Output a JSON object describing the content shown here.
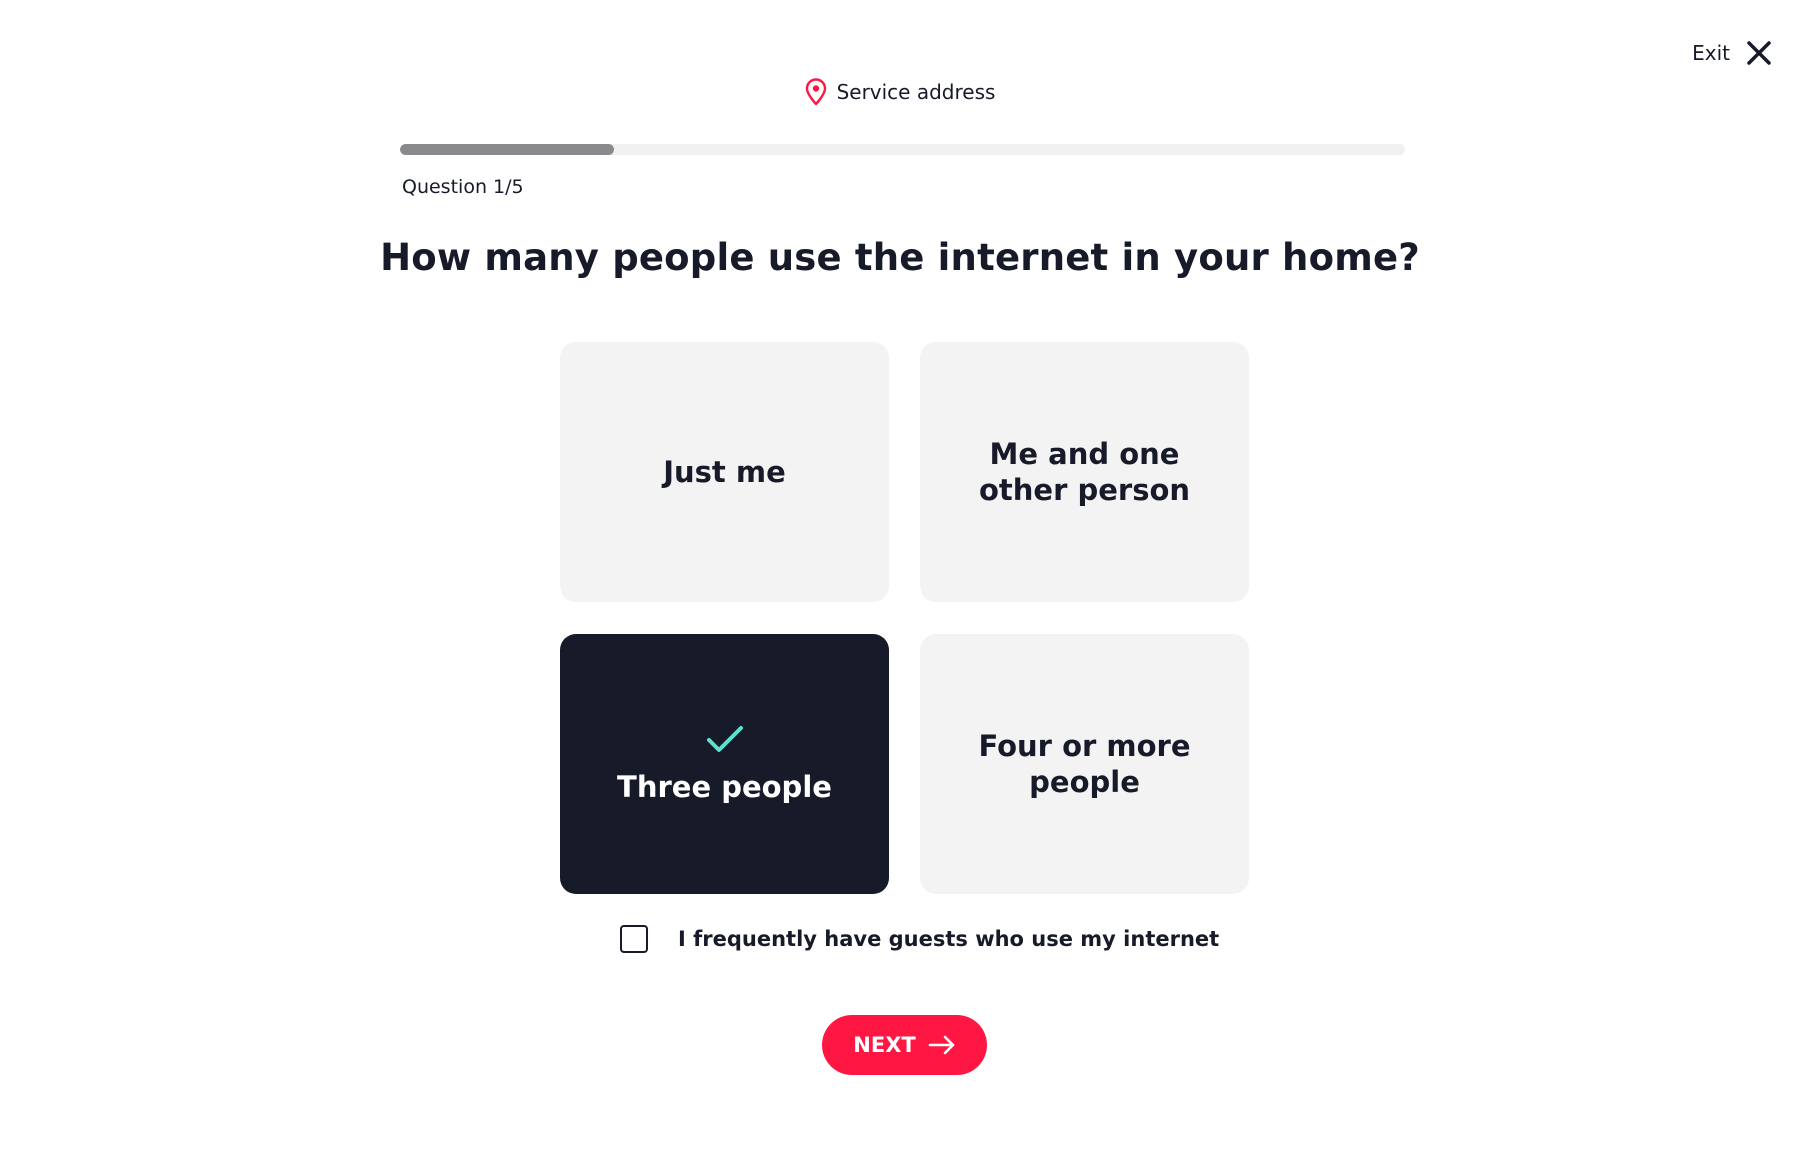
{
  "header": {
    "exit_label": "Exit",
    "exit_icon": "close-icon",
    "address_label": "Service address",
    "address_icon": "location-pin-icon"
  },
  "progress": {
    "fraction": 0.2125,
    "question_counter": "Question 1/5"
  },
  "question": {
    "title": "How many people use the internet in your home?"
  },
  "options": [
    {
      "label": "Just me",
      "selected": false
    },
    {
      "label": "Me and one other person",
      "selected": false
    },
    {
      "label": "Three people",
      "selected": true,
      "icon": "checkmark-icon"
    },
    {
      "label": "Four or more people",
      "selected": false
    }
  ],
  "guests": {
    "label": "I frequently have guests who use my internet",
    "checked": false
  },
  "next_button": {
    "label": "NEXT",
    "icon": "arrow-right-icon"
  },
  "colors": {
    "accent": "#ff1744",
    "dark": "#171b29",
    "check": "#5ee0cf",
    "tile": "#f3f3f3",
    "progress_fill": "#8a8a8d",
    "progress_track": "#f1f1f1"
  }
}
